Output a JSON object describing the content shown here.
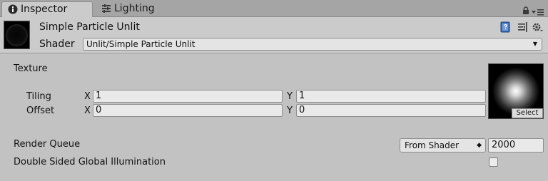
{
  "tabs": [
    {
      "label": "Inspector",
      "icon": "info-icon",
      "active": true
    },
    {
      "label": "Lighting",
      "icon": "lighting-icon",
      "active": false
    }
  ],
  "header": {
    "material_name": "Simple Particle Unlit",
    "shader_label": "Shader",
    "shader_value": "Unlit/Simple Particle Unlit"
  },
  "texture": {
    "label": "Texture",
    "select_label": "Select",
    "tiling": {
      "label": "Tiling",
      "x_label": "X",
      "x": "1",
      "y_label": "Y",
      "y": "1"
    },
    "offset": {
      "label": "Offset",
      "x_label": "X",
      "x": "0",
      "y_label": "Y",
      "y": "0"
    }
  },
  "render_queue": {
    "label": "Render Queue",
    "mode": "From Shader",
    "value": "2000"
  },
  "double_sided_gi": {
    "label": "Double Sided Global Illumination",
    "checked": false
  }
}
